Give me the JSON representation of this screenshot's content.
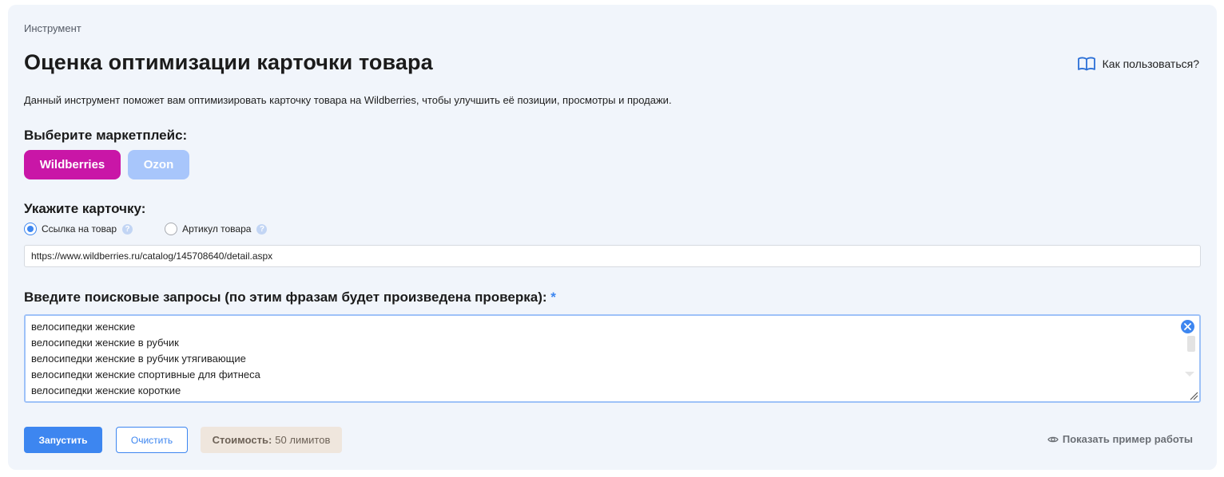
{
  "breadcrumb": "Инструмент",
  "title": "Оценка оптимизации карточки товара",
  "help_link": "Как пользоваться?",
  "description": "Данный инструмент поможет вам оптимизировать карточку товара на Wildberries, чтобы улучшить её позиции, просмотры и продажи.",
  "marketplace": {
    "label": "Выберите маркетплейс:",
    "options": [
      "Wildberries",
      "Ozon"
    ],
    "selected": "Wildberries"
  },
  "card_input": {
    "label": "Укажите карточку:",
    "radio_options": [
      "Ссылка на товар",
      "Артикул товара"
    ],
    "selected": "Ссылка на товар",
    "value": "https://www.wildberries.ru/catalog/145708640/detail.aspx"
  },
  "queries": {
    "label": "Введите поисковые запросы (по этим фразам будет произведена проверка):",
    "required_mark": "*",
    "lines": [
      "велосипедки женские",
      "велосипедки женские в рубчик",
      "велосипедки женские в рубчик утягивающие",
      "велосипедки женские спортивные для фитнеса",
      "велосипедки женские короткие"
    ]
  },
  "actions": {
    "run": "Запустить",
    "clear": "Очистить",
    "cost_label": "Стоимость:",
    "cost_value": "50 лимитов",
    "example": "Показать пример работы"
  },
  "colors": {
    "accent": "#3d86f0",
    "wildberries": "#c916a7",
    "ozon_inactive": "#a8c6fb",
    "card_bg": "#f1f5fb"
  }
}
